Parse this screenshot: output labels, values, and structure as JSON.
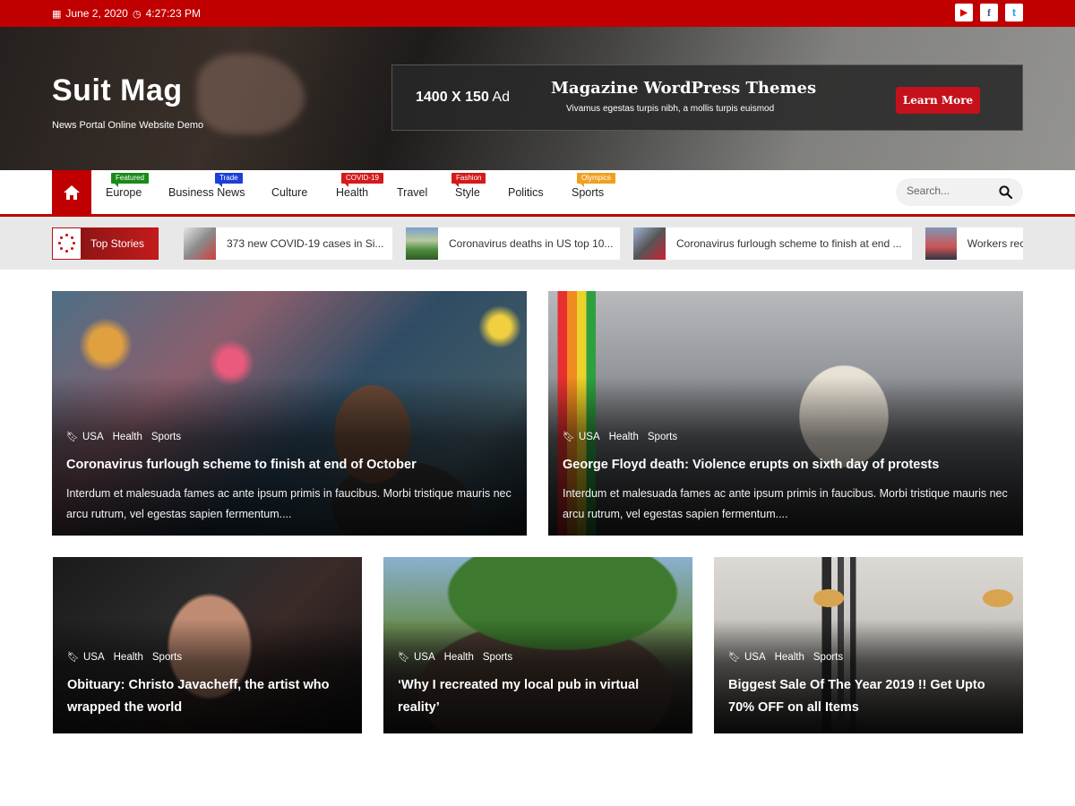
{
  "topbar": {
    "date": "June 2, 2020",
    "time": "4:27:23 PM",
    "social": [
      {
        "name": "youtube-icon",
        "glyph": "▶"
      },
      {
        "name": "facebook-icon",
        "glyph": "f"
      },
      {
        "name": "twitter-icon",
        "glyph": "t"
      }
    ]
  },
  "header": {
    "site_title": "Suit Mag",
    "tagline": "News Portal Online Website Demo",
    "ad": {
      "size_label": "1400 X 150",
      "size_suffix": " Ad",
      "headline": "Magazine WordPress Themes",
      "sub": "Vivamus egestas turpis nibh, a mollis turpis euismod",
      "button": "Learn More"
    }
  },
  "nav": {
    "items": [
      {
        "label": "Europe",
        "badge": "Featured",
        "badge_color": "#1a8a1a"
      },
      {
        "label": "Business News",
        "badge": "Trade",
        "badge_color": "#1c3fd6"
      },
      {
        "label": "Culture",
        "badge": "",
        "badge_color": ""
      },
      {
        "label": "Health",
        "badge": "COVID-19",
        "badge_color": "#d41a1a"
      },
      {
        "label": "Travel",
        "badge": "",
        "badge_color": ""
      },
      {
        "label": "Style",
        "badge": "Fashion",
        "badge_color": "#d41a1a"
      },
      {
        "label": "Politics",
        "badge": "",
        "badge_color": ""
      },
      {
        "label": "Sports",
        "badge": "Olympics",
        "badge_color": "#f0a020"
      }
    ],
    "search_placeholder": "Search..."
  },
  "ticker": {
    "label": "Top Stories",
    "items": [
      {
        "text": "373 new COVID-19 cases in Si..."
      },
      {
        "text": "Coronavirus deaths in US top 10..."
      },
      {
        "text": "Coronavirus furlough scheme to finish at end ..."
      },
      {
        "text": "Workers rec"
      }
    ]
  },
  "featured": [
    {
      "categories": [
        "USA",
        "Health",
        "Sports"
      ],
      "title": "Coronavirus furlough scheme to finish at end of October",
      "excerpt": "Interdum et malesuada fames ac ante ipsum primis in faucibus. Morbi tristique mauris nec arcu rutrum, vel egestas sapien fermentum...."
    },
    {
      "categories": [
        "USA",
        "Health",
        "Sports"
      ],
      "title": "George Floyd death: Violence erupts on sixth day of protests",
      "excerpt": "Interdum et malesuada fames ac ante ipsum primis in faucibus. Morbi tristique mauris nec arcu rutrum, vel egestas sapien fermentum...."
    }
  ],
  "grid": [
    {
      "categories": [
        "USA",
        "Health",
        "Sports"
      ],
      "title": "Obituary: Christo Javacheff, the artist who wrapped the world"
    },
    {
      "categories": [
        "USA",
        "Health",
        "Sports"
      ],
      "title": "‘Why I recreated my local pub in virtual reality’"
    },
    {
      "categories": [
        "USA",
        "Health",
        "Sports"
      ],
      "title": "Biggest Sale Of The Year 2019 !! Get Upto 70% OFF on all Items"
    }
  ],
  "colors": {
    "brand": "#c00000",
    "ad_button": "#c4111b"
  }
}
